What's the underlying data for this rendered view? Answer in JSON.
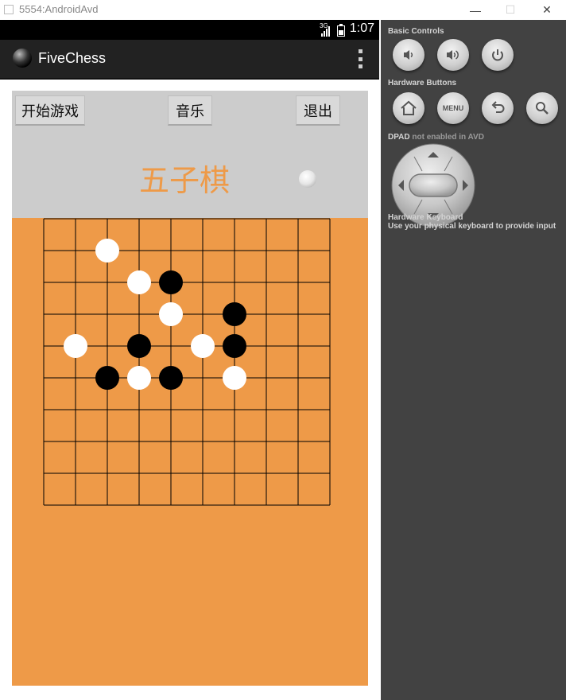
{
  "window": {
    "title": "5554:AndroidAvd",
    "minimize_glyph": "—",
    "maximize_glyph": "☐",
    "close_glyph": "✕"
  },
  "status_bar": {
    "network": "3G",
    "time": "1:07"
  },
  "action_bar": {
    "app_title": "FiveChess",
    "app_icon": "black-stone-icon",
    "overflow_icon": "overflow-menu-icon"
  },
  "controls": {
    "start_label": "开始游戏",
    "music_label": "音乐",
    "exit_label": "退出"
  },
  "game": {
    "title": "五子棋",
    "current_turn": "white",
    "board_size": 10,
    "stones": [
      {
        "row": 1,
        "col": 2,
        "color": "white"
      },
      {
        "row": 2,
        "col": 3,
        "color": "white"
      },
      {
        "row": 2,
        "col": 4,
        "color": "black"
      },
      {
        "row": 3,
        "col": 4,
        "color": "white"
      },
      {
        "row": 3,
        "col": 6,
        "color": "black"
      },
      {
        "row": 4,
        "col": 1,
        "color": "white"
      },
      {
        "row": 4,
        "col": 3,
        "color": "black"
      },
      {
        "row": 4,
        "col": 5,
        "color": "white"
      },
      {
        "row": 4,
        "col": 6,
        "color": "black"
      },
      {
        "row": 5,
        "col": 2,
        "color": "black"
      },
      {
        "row": 5,
        "col": 3,
        "color": "white"
      },
      {
        "row": 5,
        "col": 4,
        "color": "black"
      },
      {
        "row": 5,
        "col": 6,
        "color": "white"
      }
    ]
  },
  "emulator": {
    "basic_controls_label": "Basic Controls",
    "hardware_buttons_label": "Hardware Buttons",
    "menu_label": "MENU",
    "dpad_label": "DPAD",
    "dpad_status": "not enabled in AVD",
    "keyboard_label": "Hardware Keyboard",
    "keyboard_hint": "Use your physical keyboard to provide input"
  },
  "colors": {
    "board": "#ee9a48",
    "header_panel": "#cccccc",
    "title_accent": "#ee9a48",
    "emulator_panel": "#424242",
    "action_bar": "#222222"
  }
}
